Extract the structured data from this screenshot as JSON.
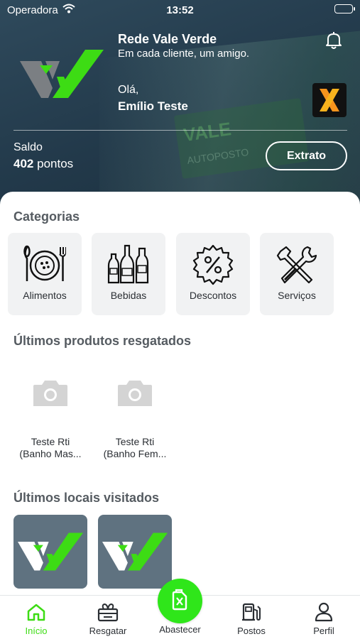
{
  "status": {
    "carrier": "Operadora",
    "time": "13:52"
  },
  "header": {
    "brand_name": "Rede Vale Verde",
    "slogan": "Em cada cliente, um amigo.",
    "greeting": "Olá,",
    "user_name": "Emílio Teste",
    "saldo_label": "Saldo",
    "saldo_amount": "402",
    "saldo_unit": "pontos",
    "extrato_label": "Extrato"
  },
  "categories": {
    "title": "Categorias",
    "items": [
      {
        "label": "Alimentos",
        "icon": "food-plate-icon"
      },
      {
        "label": "Bebidas",
        "icon": "bottles-icon"
      },
      {
        "label": "Descontos",
        "icon": "discount-badge-icon"
      },
      {
        "label": "Serviços",
        "icon": "tools-icon"
      }
    ]
  },
  "recent_products": {
    "title": "Últimos produtos resgatados",
    "items": [
      {
        "line1": "Teste Rti",
        "line2": "(Banho Mas..."
      },
      {
        "line1": "Teste Rti",
        "line2": "(Banho Fem..."
      }
    ]
  },
  "recent_places": {
    "title": "Últimos locais visitados"
  },
  "tabbar": {
    "items": [
      {
        "label": "Início",
        "icon": "home-icon",
        "active": true
      },
      {
        "label": "Resgatar",
        "icon": "gift-icon"
      },
      {
        "label": "Abastecer",
        "icon": "fuel-can-icon"
      },
      {
        "label": "Postos",
        "icon": "gas-pump-icon"
      },
      {
        "label": "Perfil",
        "icon": "user-icon"
      }
    ]
  },
  "colors": {
    "accent": "#3ddc14",
    "fab": "#2fe61a",
    "header": "#2b4456"
  }
}
